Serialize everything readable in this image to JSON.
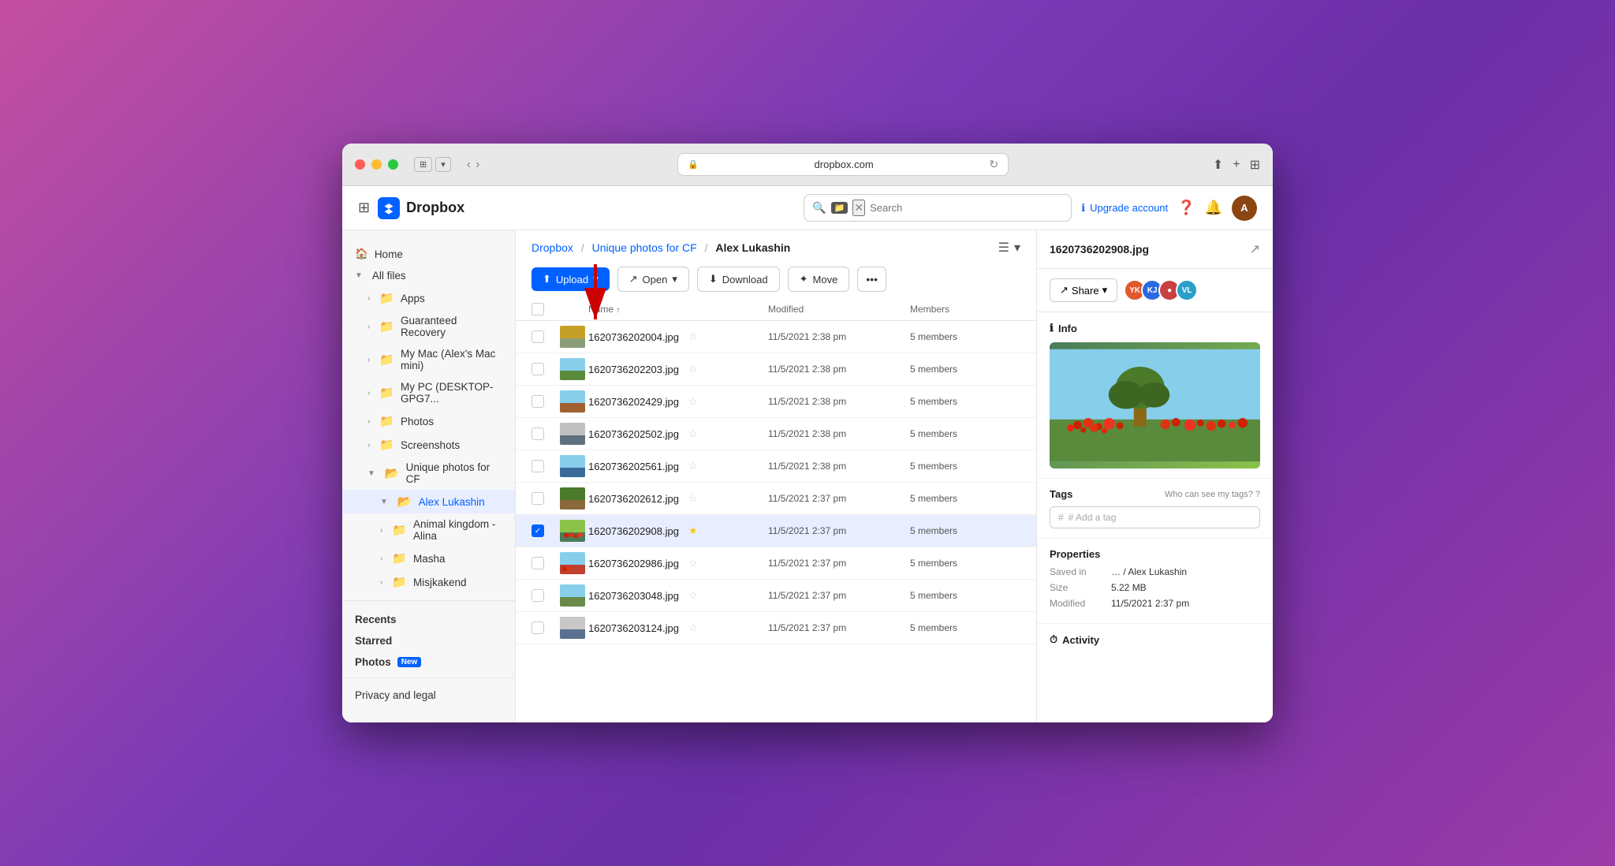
{
  "browser": {
    "url": "dropbox.com",
    "upgrade_label": "Upgrade account"
  },
  "header": {
    "app_name": "Dropbox",
    "search_placeholder": "Search"
  },
  "sidebar": {
    "home_label": "Home",
    "all_files_label": "All files",
    "items": [
      {
        "id": "apps",
        "label": "Apps",
        "indent": 1
      },
      {
        "id": "guaranteed-recovery",
        "label": "Guaranteed Recovery",
        "indent": 1
      },
      {
        "id": "my-mac",
        "label": "My Mac (Alex's Mac mini)",
        "indent": 1
      },
      {
        "id": "my-pc",
        "label": "My PC (DESKTOP-GPG7...",
        "indent": 1
      },
      {
        "id": "photos",
        "label": "Photos",
        "indent": 1
      },
      {
        "id": "screenshots",
        "label": "Screenshots",
        "indent": 1
      },
      {
        "id": "unique-photos",
        "label": "Unique photos for CF",
        "indent": 1
      },
      {
        "id": "alex-lukashin",
        "label": "Alex Lukashin",
        "indent": 2,
        "active": true
      },
      {
        "id": "animal-kingdom",
        "label": "Animal kingdom - Alina",
        "indent": 2
      },
      {
        "id": "masha",
        "label": "Masha",
        "indent": 2
      },
      {
        "id": "misjkakend",
        "label": "Misjkakend",
        "indent": 2
      }
    ],
    "recents_label": "Recents",
    "starred_label": "Starred",
    "photos_label": "Photos",
    "photos_new_badge": "New",
    "privacy_label": "Privacy and legal"
  },
  "breadcrumb": {
    "parts": [
      "Dropbox",
      "Unique photos for CF",
      "Alex Lukashin"
    ]
  },
  "toolbar": {
    "upload_label": "Upload",
    "open_label": "Open",
    "download_label": "Download",
    "move_label": "Move"
  },
  "table": {
    "col_name": "Name",
    "col_modified": "Modified",
    "col_members": "Members",
    "rows": [
      {
        "name": "1620736202004.jpg",
        "modified": "11/5/2021 2:38 pm",
        "members": "5 members",
        "selected": false
      },
      {
        "name": "1620736202203.jpg",
        "modified": "11/5/2021 2:38 pm",
        "members": "5 members",
        "selected": false
      },
      {
        "name": "1620736202429.jpg",
        "modified": "11/5/2021 2:38 pm",
        "members": "5 members",
        "selected": false
      },
      {
        "name": "1620736202502.jpg",
        "modified": "11/5/2021 2:38 pm",
        "members": "5 members",
        "selected": false
      },
      {
        "name": "1620736202561.jpg",
        "modified": "11/5/2021 2:38 pm",
        "members": "5 members",
        "selected": false
      },
      {
        "name": "1620736202612.jpg",
        "modified": "11/5/2021 2:37 pm",
        "members": "5 members",
        "selected": false
      },
      {
        "name": "1620736202908.jpg",
        "modified": "11/5/2021 2:37 pm",
        "members": "5 members",
        "selected": true
      },
      {
        "name": "1620736202986.jpg",
        "modified": "11/5/2021 2:37 pm",
        "members": "5 members",
        "selected": false
      },
      {
        "name": "1620736203048.jpg",
        "modified": "11/5/2021 2:37 pm",
        "members": "5 members",
        "selected": false
      },
      {
        "name": "1620736203124.jpg",
        "modified": "11/5/2021 2:37 pm",
        "members": "5 members",
        "selected": false
      }
    ]
  },
  "right_panel": {
    "title": "1620736202908.jpg",
    "share_label": "Share",
    "info_label": "Info",
    "tags_label": "Tags",
    "tags_who_label": "Who can see my tags?",
    "tag_placeholder": "# Add a tag",
    "properties_label": "Properties",
    "saved_in_label": "Saved in",
    "saved_in_value": "… / Alex Lukashin",
    "size_label": "Size",
    "size_value": "5.22 MB",
    "modified_label": "Modified",
    "modified_value": "11/5/2021 2:37 pm",
    "activity_label": "Activity",
    "members": [
      {
        "initials": "YK",
        "color": "#e0572a"
      },
      {
        "initials": "KJ",
        "color": "#2a6ae0"
      },
      {
        "initials": "VL",
        "color": "#2aa0e0"
      }
    ]
  },
  "colors": {
    "accent": "#0061FF",
    "selected_row_bg": "#e8eeff",
    "folder_icon": "#5b8dd9"
  }
}
